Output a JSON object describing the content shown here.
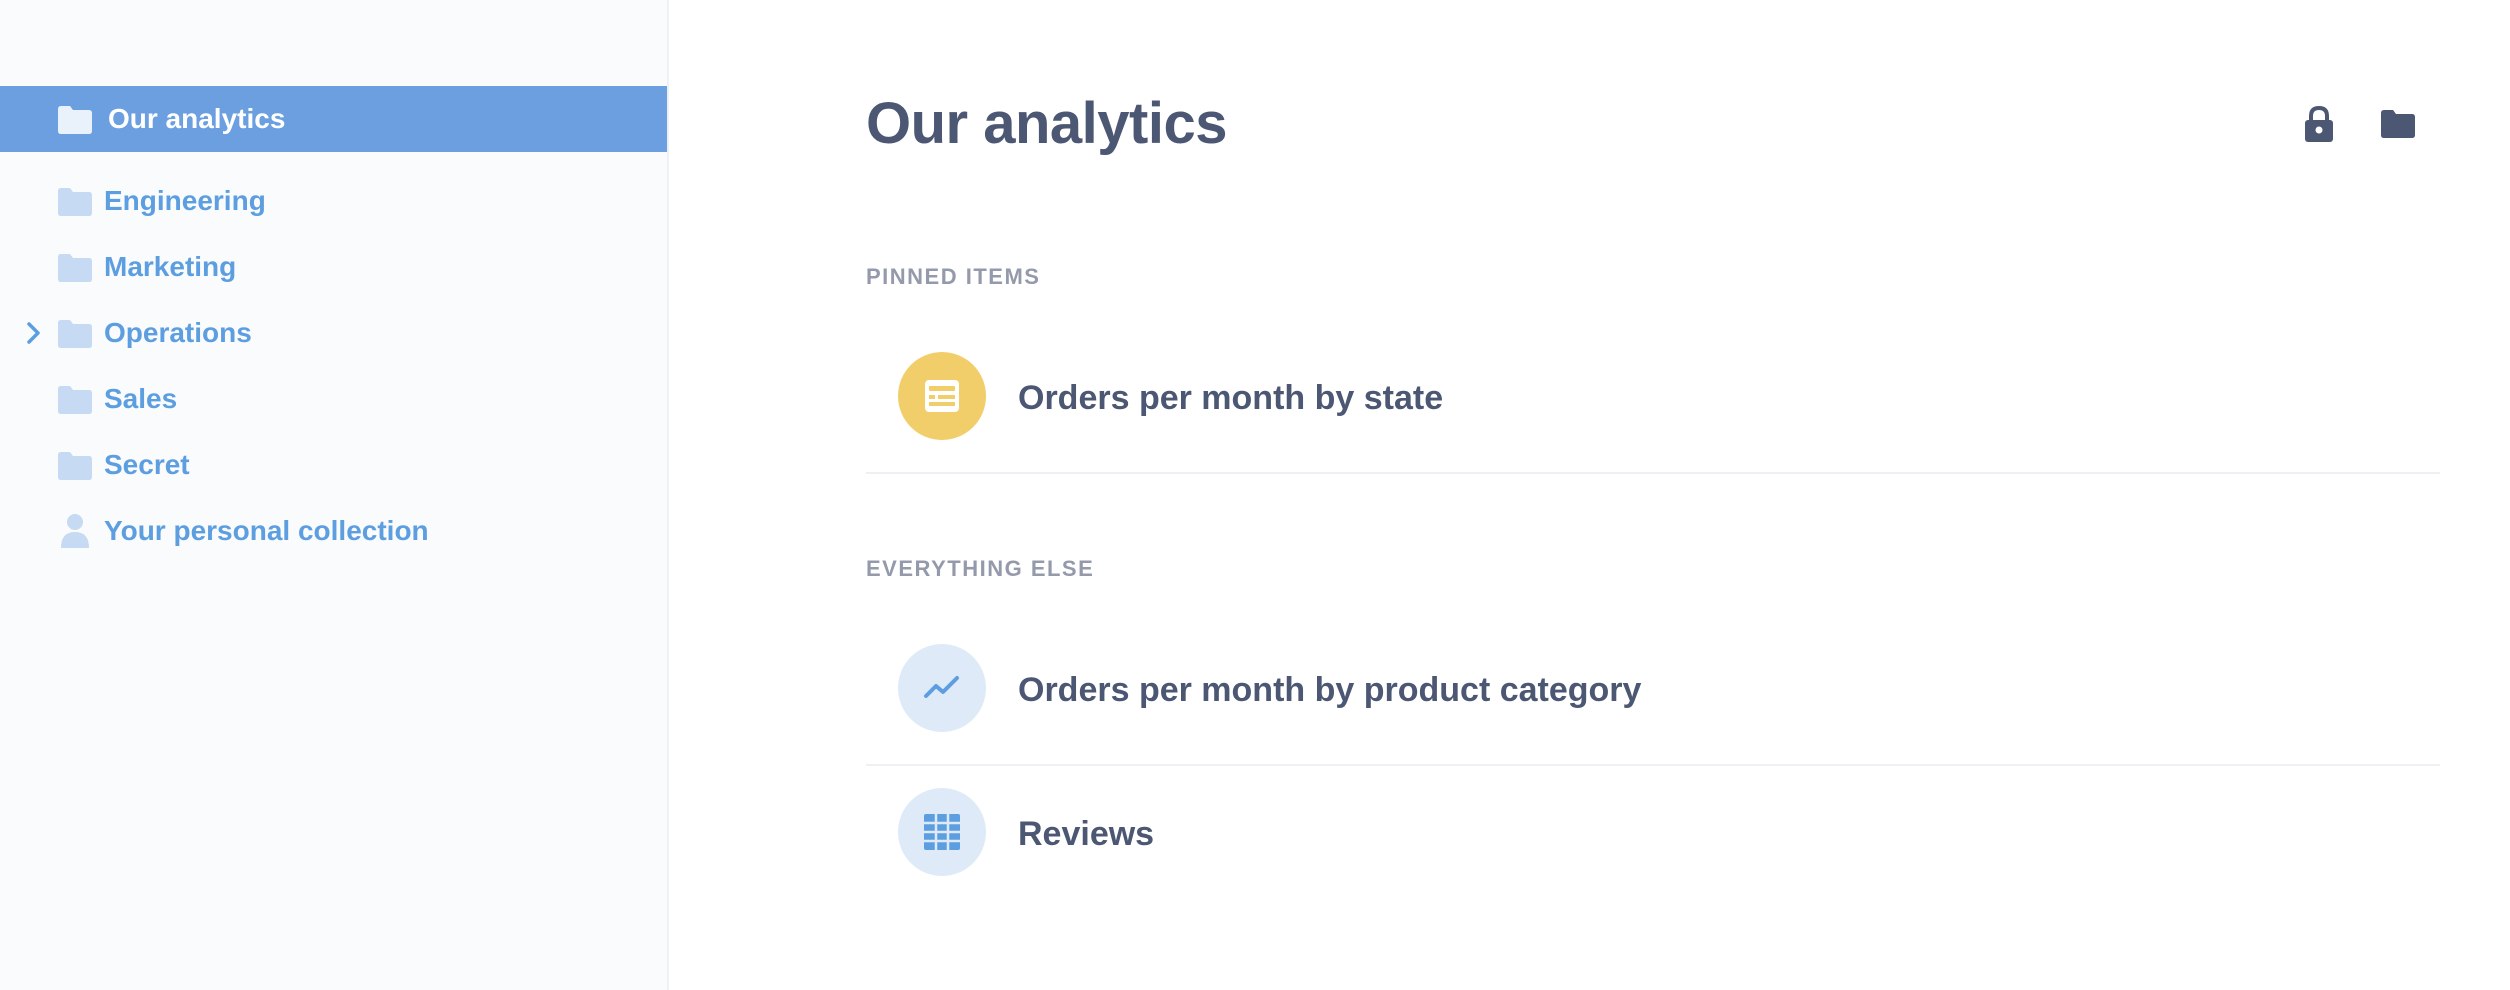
{
  "sidebar": {
    "active": {
      "label": "Our analytics",
      "icon": "folder-icon"
    },
    "items": [
      {
        "label": "Engineering",
        "icon": "folder-icon",
        "expandable": false
      },
      {
        "label": "Marketing",
        "icon": "folder-icon",
        "expandable": false
      },
      {
        "label": "Operations",
        "icon": "folder-icon",
        "expandable": true
      },
      {
        "label": "Sales",
        "icon": "folder-icon",
        "expandable": false
      },
      {
        "label": "Secret",
        "icon": "folder-icon",
        "expandable": false
      },
      {
        "label": "Your personal collection",
        "icon": "person-icon",
        "expandable": false
      }
    ]
  },
  "main": {
    "title": "Our analytics",
    "header_icons": [
      "lock-icon",
      "folder-icon"
    ],
    "pinned": {
      "label": "PINNED ITEMS",
      "items": [
        {
          "name": "Orders per month by state",
          "icon": "dashboard-icon"
        }
      ]
    },
    "everything_else": {
      "label": "EVERYTHING ELSE",
      "items": [
        {
          "name": "Orders per month by product category",
          "icon": "line-chart-icon"
        },
        {
          "name": "Reviews",
          "icon": "grid-table-icon"
        }
      ]
    }
  },
  "colors": {
    "accent": "#6b9fe0",
    "link": "#5d9ee0",
    "text": "#4c5773",
    "muted": "#949aab",
    "sidebar_bg": "#f9fbfc",
    "pinned_icon_bg": "#f2ce6b",
    "item_icon_bg": "#dfeaf9"
  }
}
